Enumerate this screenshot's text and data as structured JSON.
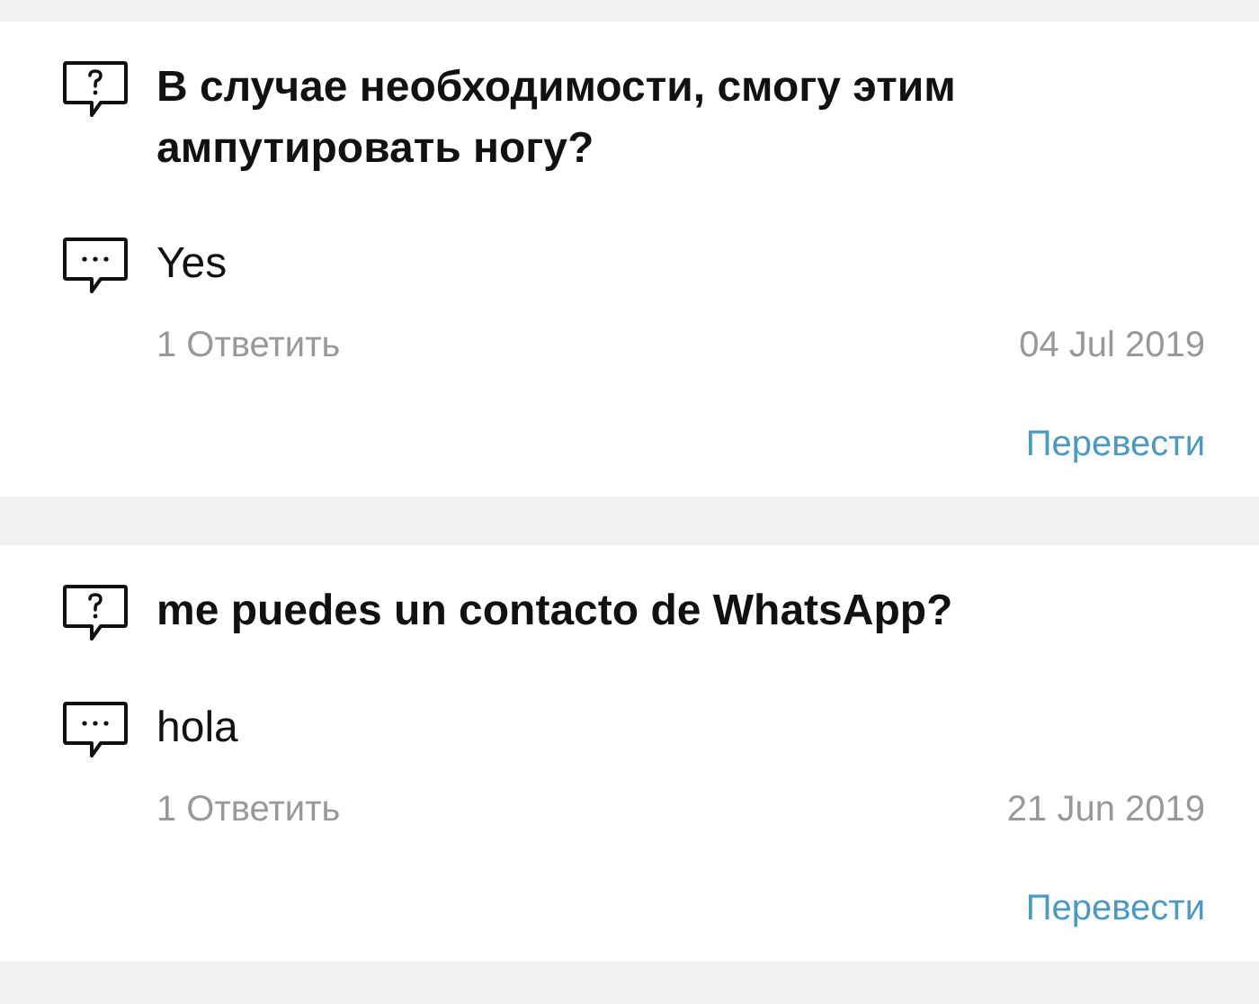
{
  "items": [
    {
      "question": "В случае необходимости, смогу этим ампутировать ногу?",
      "answer": "Yes",
      "reply_link": "1 Ответить",
      "date": "04 Jul 2019",
      "translate_link": "Перевести"
    },
    {
      "question": "me puedes un contacto de WhatsApp?",
      "answer": "hola",
      "reply_link": "1 Ответить",
      "date": "21 Jun 2019",
      "translate_link": "Перевести"
    }
  ]
}
